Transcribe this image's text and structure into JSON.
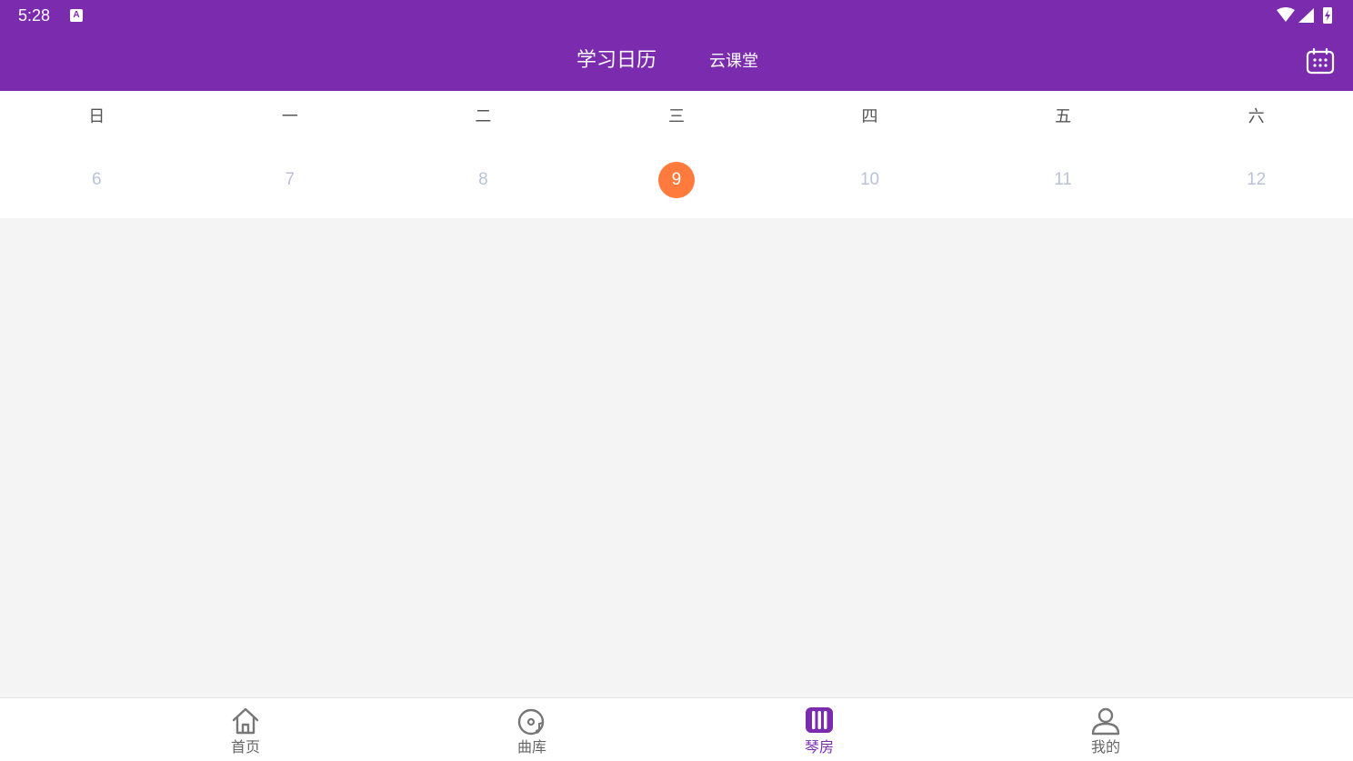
{
  "status_bar": {
    "time": "5:28",
    "notification_letter": "A"
  },
  "header": {
    "tab_main": "学习日历",
    "tab_sub": "云课堂",
    "calendar_icon": "calendar-icon"
  },
  "calendar": {
    "weekdays": [
      "日",
      "一",
      "二",
      "三",
      "四",
      "五",
      "六"
    ],
    "dates": [
      "6",
      "7",
      "8",
      "9",
      "10",
      "11",
      "12"
    ],
    "selected_index": 3
  },
  "bottom_nav": {
    "items": [
      {
        "label": "首页",
        "icon": "home-icon"
      },
      {
        "label": "曲库",
        "icon": "music-disc-icon"
      },
      {
        "label": "琴房",
        "icon": "piano-icon"
      },
      {
        "label": "我的",
        "icon": "user-icon"
      }
    ],
    "active_index": 2
  },
  "colors": {
    "primary": "#7b2bad",
    "accent": "#ff7a3d",
    "date_text": "#b8c2d8",
    "background": "#f4f4f4"
  }
}
